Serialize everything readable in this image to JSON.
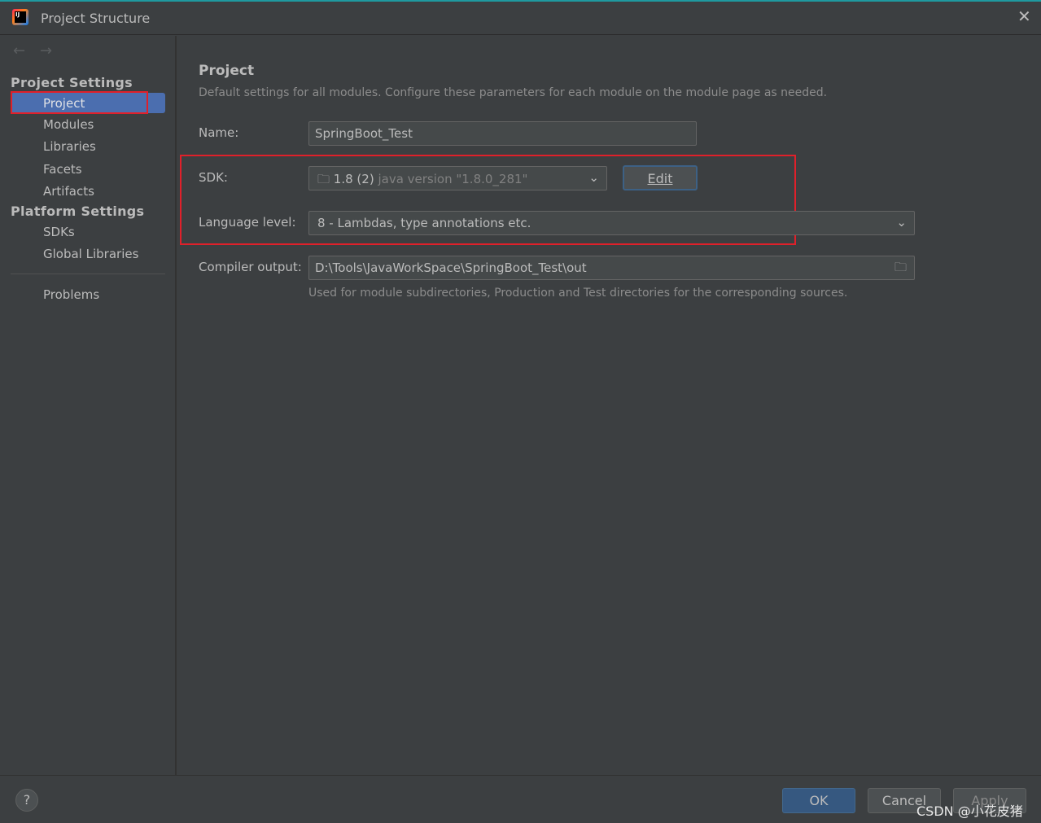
{
  "window": {
    "title": "Project Structure"
  },
  "sidebar": {
    "project_settings": "Project Settings",
    "project_items": [
      "Project",
      "Modules",
      "Libraries",
      "Facets",
      "Artifacts"
    ],
    "platform_settings": "Platform Settings",
    "platform_items": [
      "SDKs",
      "Global Libraries"
    ],
    "problems": "Problems",
    "selected": "Project"
  },
  "main": {
    "heading": "Project",
    "description": "Default settings for all modules. Configure these parameters for each module on the module page as needed.",
    "name_label": "Name:",
    "name_value": "SpringBoot_Test",
    "sdk_label": "SDK:",
    "sdk_version": "1.8 (2)",
    "sdk_detail": "java version \"1.8.0_281\"",
    "edit_label": "Edit",
    "language_label": "Language level:",
    "language_value": "8 - Lambdas, type annotations etc.",
    "compiler_label": "Compiler output:",
    "compiler_value": "D:\\Tools\\JavaWorkSpace\\SpringBoot_Test\\out",
    "compiler_hint": "Used for module subdirectories, Production and Test directories for the corresponding sources."
  },
  "footer": {
    "help": "?",
    "ok": "OK",
    "cancel": "Cancel",
    "apply": "Apply",
    "watermark": "CSDN @小花皮猪"
  },
  "colors": {
    "selection": "#4b6eaf",
    "highlight": "#e0202a",
    "ok_button": "#365880"
  }
}
